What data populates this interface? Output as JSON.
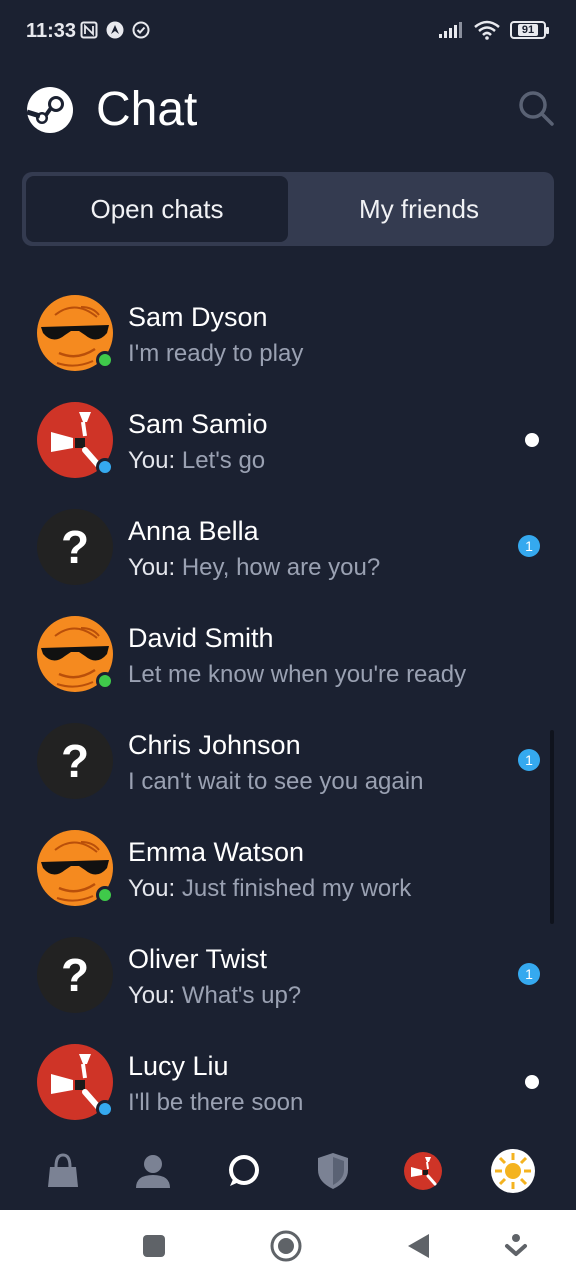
{
  "status_bar": {
    "time": "11:33",
    "battery": "91",
    "left_icons": [
      "nfc-icon",
      "android-auto-icon",
      "check-circle-icon"
    ],
    "right_icons": [
      "signal-icon",
      "wifi-icon",
      "battery-icon"
    ]
  },
  "header": {
    "title": "Chat",
    "logo_icon": "steam-logo-icon",
    "search_icon": "search-icon"
  },
  "tabs": [
    {
      "label": "Open chats",
      "active": true
    },
    {
      "label": "My friends",
      "active": false
    }
  ],
  "chats": [
    {
      "name": "Sam Dyson",
      "you_prefix": "",
      "message": "I'm ready to play",
      "avatar": "sunglasses-emoji",
      "status": "online",
      "indicator": "none"
    },
    {
      "name": "Sam Samio",
      "you_prefix": "You:",
      "message": " Let's go",
      "avatar": "rust-logo",
      "status": "ingame",
      "indicator": "dot"
    },
    {
      "name": "Anna Bella",
      "you_prefix": "You:",
      "message": " Hey, how are you?",
      "avatar": "question-mark",
      "status": "none",
      "indicator": "badge",
      "badge_count": "1"
    },
    {
      "name": "David Smith",
      "you_prefix": "",
      "message": "Let me know when you're ready",
      "avatar": "sunglasses-emoji",
      "status": "online",
      "indicator": "none"
    },
    {
      "name": "Chris Johnson",
      "you_prefix": "",
      "message": "I can't wait to see you again",
      "avatar": "question-mark",
      "status": "none",
      "indicator": "badge",
      "badge_count": "1"
    },
    {
      "name": "Emma Watson",
      "you_prefix": "You:",
      "message": " Just finished my work",
      "avatar": "sunglasses-emoji",
      "status": "online",
      "indicator": "none"
    },
    {
      "name": "Oliver Twist",
      "you_prefix": "You:",
      "message": " What's up?",
      "avatar": "question-mark",
      "status": "none",
      "indicator": "badge",
      "badge_count": "1"
    },
    {
      "name": "Lucy Liu",
      "you_prefix": "",
      "message": "I'll be there soon",
      "avatar": "rust-logo",
      "status": "ingame",
      "indicator": "dot"
    }
  ],
  "bottom_nav": [
    "store-bag-icon",
    "profile-icon",
    "chat-bubble-icon",
    "guard-shield-icon",
    "rust-game-icon",
    "sun-avatar-icon"
  ],
  "system_nav": [
    "recents-icon",
    "home-icon",
    "back-icon",
    "assistant-icon"
  ],
  "colors": {
    "background": "#1b2131",
    "tab_container": "#343b50",
    "online": "#3fc94a",
    "ingame": "#35a9ef",
    "secondary_text": "#9aa1b2"
  }
}
